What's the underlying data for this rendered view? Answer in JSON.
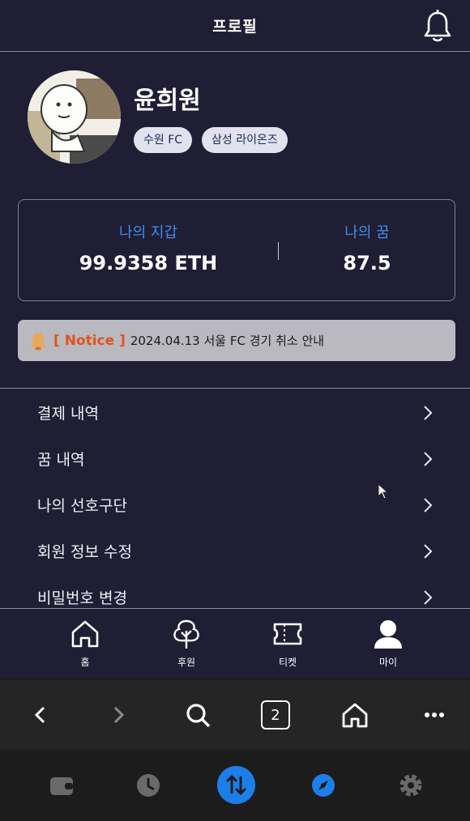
{
  "header": {
    "title": "프로필",
    "bell_icon": "bell-icon"
  },
  "profile": {
    "name": "윤희원",
    "tags": [
      "수원 FC",
      "삼성 라이온즈"
    ]
  },
  "wallet": {
    "left_label": "나의 지갑",
    "left_value": "99.9358 ETH",
    "right_label": "나의 꿈",
    "right_value": "87.5",
    "label_color": "#3e8ee6"
  },
  "notice": {
    "tag": "[ Notice ]",
    "text": "2024.04.13 서울 FC 경기 취소 안내",
    "tag_color": "#e2531c"
  },
  "menu": [
    {
      "label": "결제 내역"
    },
    {
      "label": "꿈 내역"
    },
    {
      "label": "나의 선호구단"
    },
    {
      "label": "회원 정보 수정"
    },
    {
      "label": "비밀번호 변경"
    }
  ],
  "tabs": [
    {
      "label": "홈",
      "icon": "home-icon"
    },
    {
      "label": "후원",
      "icon": "tree-icon"
    },
    {
      "label": "티켓",
      "icon": "ticket-icon"
    },
    {
      "label": "마이",
      "icon": "user-icon"
    }
  ],
  "browser": {
    "tab_count": "2"
  },
  "colors": {
    "background": "#1f1e35",
    "accent": "#1c7fe8"
  }
}
